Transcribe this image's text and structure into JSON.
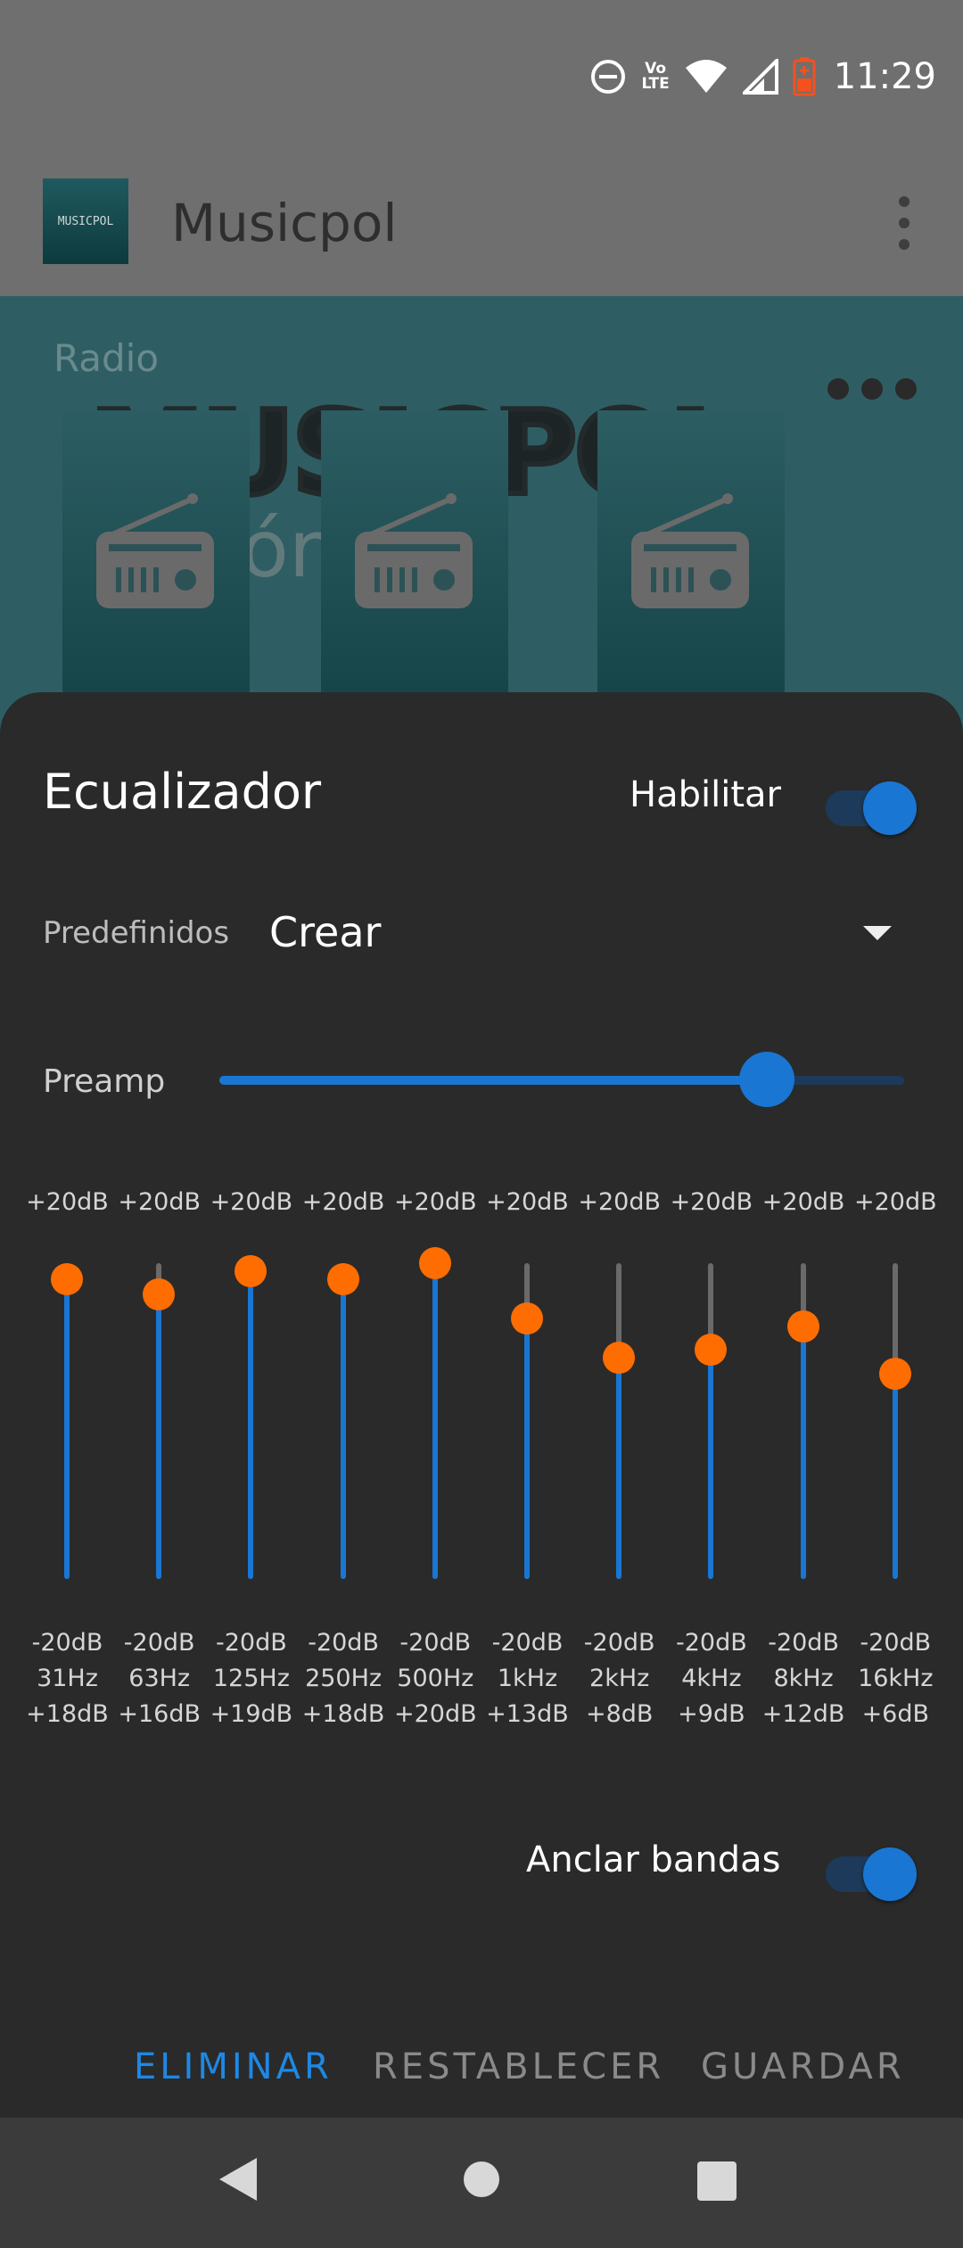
{
  "status_bar": {
    "time": "11:29",
    "volte_top": "Vo",
    "volte_bottom": "LTE",
    "icons": [
      "do-not-disturb-icon",
      "volte-icon",
      "wifi-icon",
      "signal-icon",
      "battery-charging-icon"
    ],
    "battery_color": "#f4511e"
  },
  "app_bar": {
    "title": "Musicpol",
    "logo_text": "MUSICPOL"
  },
  "background": {
    "section_label": "Radio",
    "brand_text": "MUSICPOL",
    "brand_sub": "ór"
  },
  "equalizer": {
    "title": "Ecualizador",
    "enable_label": "Habilitar",
    "enabled": true,
    "presets_label": "Predefinidos",
    "preset_value": "Crear",
    "preamp_label": "Preamp",
    "preamp_level": 0.8,
    "range_max": "+20dB",
    "range_min": "-20dB",
    "bands": [
      {
        "freq": "31Hz",
        "gain": "+18dB",
        "level": 0.95
      },
      {
        "freq": "63Hz",
        "gain": "+16dB",
        "level": 0.9
      },
      {
        "freq": "125Hz",
        "gain": "+19dB",
        "level": 0.975
      },
      {
        "freq": "250Hz",
        "gain": "+18dB",
        "level": 0.95
      },
      {
        "freq": "500Hz",
        "gain": "+20dB",
        "level": 1.0
      },
      {
        "freq": "1kHz",
        "gain": "+13dB",
        "level": 0.825
      },
      {
        "freq": "2kHz",
        "gain": "+8dB",
        "level": 0.7
      },
      {
        "freq": "4kHz",
        "gain": "+9dB",
        "level": 0.725
      },
      {
        "freq": "8kHz",
        "gain": "+12dB",
        "level": 0.8
      },
      {
        "freq": "16kHz",
        "gain": "+6dB",
        "level": 0.65
      }
    ],
    "anchor_label": "Anclar bandas",
    "anchor_enabled": true,
    "actions": {
      "delete": "ELIMINAR",
      "reset": "RESTABLECER",
      "save": "GUARDAR"
    }
  },
  "colors": {
    "accent": "#1976d2",
    "thumb": "#ff6d00",
    "action_active": "#1e88e5",
    "action_inactive": "#8a8a8a",
    "sheet": "#2a2a2a"
  }
}
